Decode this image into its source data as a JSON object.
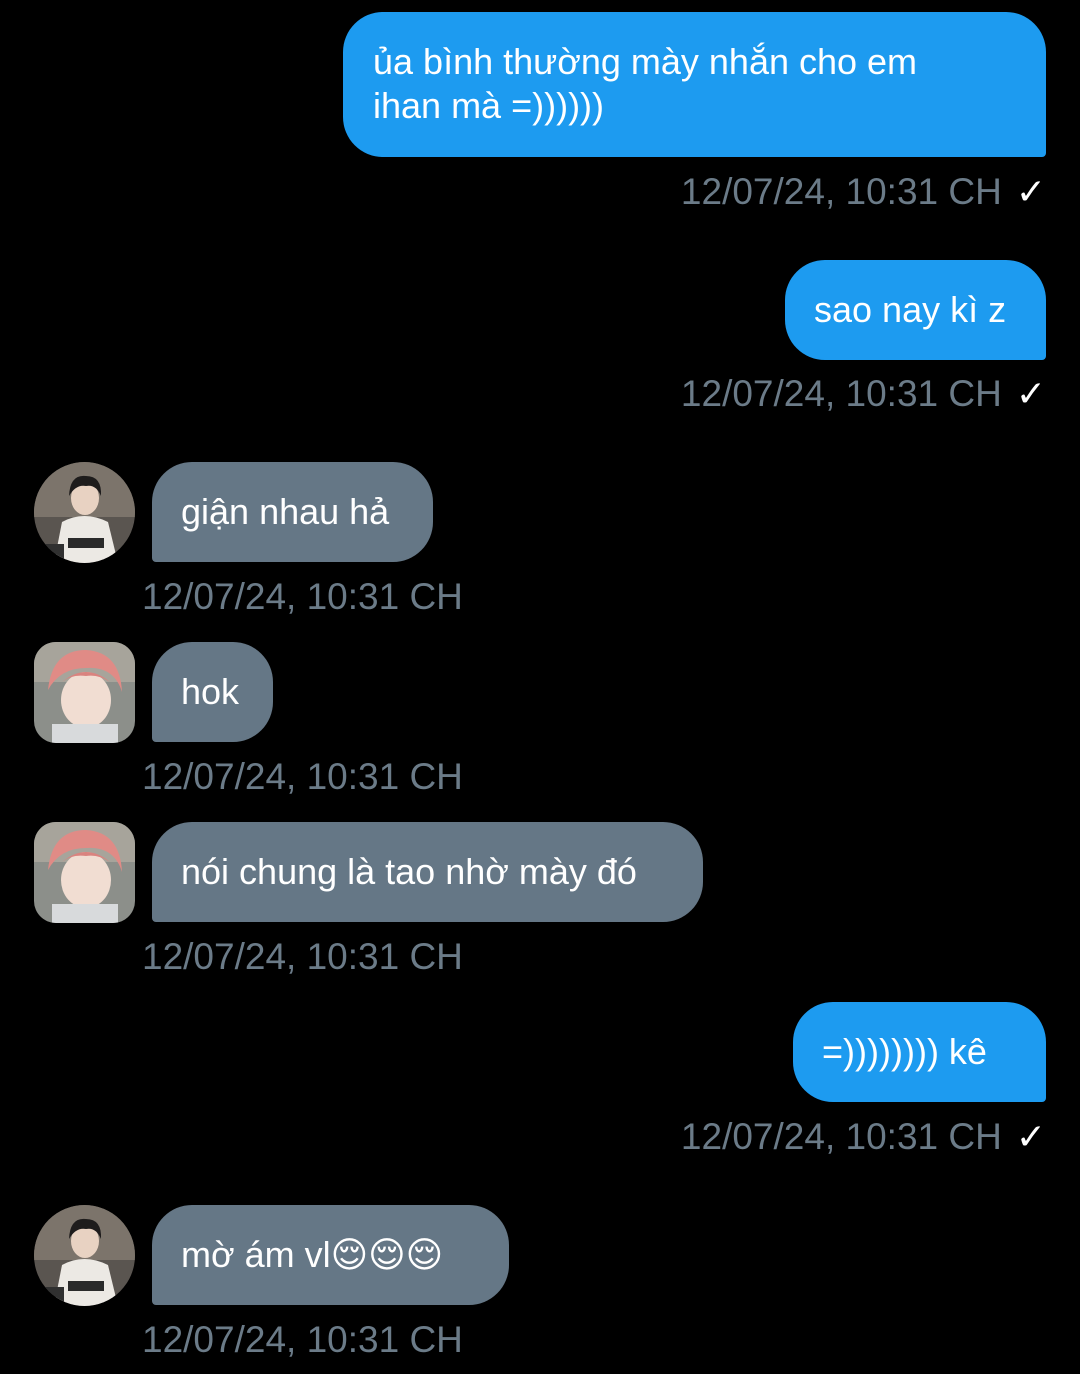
{
  "messages": [
    {
      "direction": "out",
      "text": "ủa bình thường mày nhắn cho em ihan mà =))))))",
      "line1": "ủa bình thường mày nhắn cho em",
      "line2": "ihan mà =))))))",
      "timestamp": "12/07/24, 10:31 CH",
      "status_icon": "checkmark-icon",
      "check": "✓"
    },
    {
      "direction": "out",
      "text": "sao nay kì z",
      "timestamp": "12/07/24, 10:31 CH",
      "status_icon": "checkmark-icon",
      "check": "✓"
    },
    {
      "direction": "in",
      "sender_avatar": "avatar-a",
      "text": "giận nhau hả",
      "timestamp": "12/07/24, 10:31 CH"
    },
    {
      "direction": "in",
      "sender_avatar": "avatar-b",
      "text": "hok",
      "timestamp": "12/07/24, 10:31 CH"
    },
    {
      "direction": "in",
      "sender_avatar": "avatar-b",
      "text": "nói chung là tao nhờ mày đó",
      "timestamp": "12/07/24, 10:31 CH"
    },
    {
      "direction": "out",
      "text": "=)))))))) kê",
      "timestamp": "12/07/24, 10:31 CH",
      "status_icon": "checkmark-icon",
      "check": "✓"
    },
    {
      "direction": "in",
      "sender_avatar": "avatar-a",
      "text": "mờ ám vl😌😌😌",
      "text_main": "mờ ám vl",
      "emoji": "😌😌😌",
      "timestamp": "12/07/24, 10:31 CH"
    }
  ],
  "colors": {
    "background": "#000000",
    "outgoing_bubble": "#1d9bf0",
    "incoming_bubble": "#657786",
    "timestamp": "#6b7b88"
  }
}
